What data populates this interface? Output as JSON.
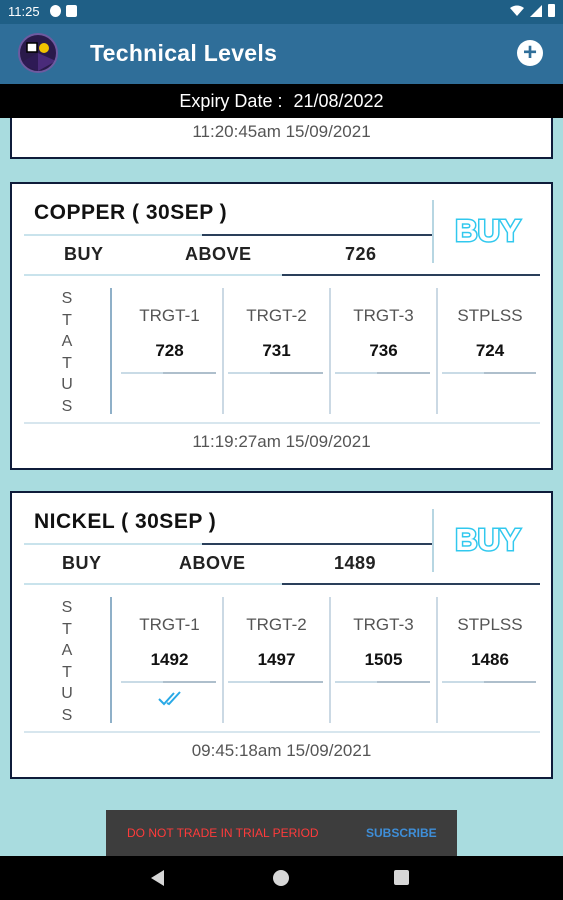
{
  "status_bar": {
    "time": "11:25"
  },
  "app_bar": {
    "title": "Technical Levels",
    "add_icon": "plus-icon"
  },
  "expiry": {
    "label": "Expiry Date :",
    "value": "21/08/2022"
  },
  "partial_card": {
    "timestamp": "11:20:45am 15/09/2021"
  },
  "cards": [
    {
      "name": "COPPER ( 30SEP )",
      "signal": "BUY",
      "signal_color": "#31c8ee",
      "action": "BUY",
      "condition": "ABOVE",
      "price": "726",
      "status_letters": [
        "S",
        "T",
        "A",
        "T",
        "U",
        "S"
      ],
      "targets": [
        {
          "label": "TRGT-1",
          "value": "728",
          "hit": false
        },
        {
          "label": "TRGT-2",
          "value": "731",
          "hit": false
        },
        {
          "label": "TRGT-3",
          "value": "736",
          "hit": false
        },
        {
          "label": "STPLSS",
          "value": "724",
          "hit": false
        }
      ],
      "timestamp": "11:19:27am 15/09/2021"
    },
    {
      "name": "NICKEL ( 30SEP )",
      "signal": "BUY",
      "signal_color": "#31c8ee",
      "action": "BUY",
      "condition": "ABOVE",
      "price": "1489",
      "status_letters": [
        "S",
        "T",
        "A",
        "T",
        "U",
        "S"
      ],
      "targets": [
        {
          "label": "TRGT-1",
          "value": "1492",
          "hit": true
        },
        {
          "label": "TRGT-2",
          "value": "1497",
          "hit": false
        },
        {
          "label": "TRGT-3",
          "value": "1505",
          "hit": false
        },
        {
          "label": "STPLSS",
          "value": "1486",
          "hit": false
        }
      ],
      "timestamp": "09:45:18am 15/09/2021"
    }
  ],
  "toast": {
    "message": "DO NOT TRADE IN TRIAL PERIOD",
    "action": "SUBSCRIBE"
  },
  "nav_bar": {
    "icons": [
      "back-icon",
      "home-icon",
      "recents-icon"
    ]
  }
}
